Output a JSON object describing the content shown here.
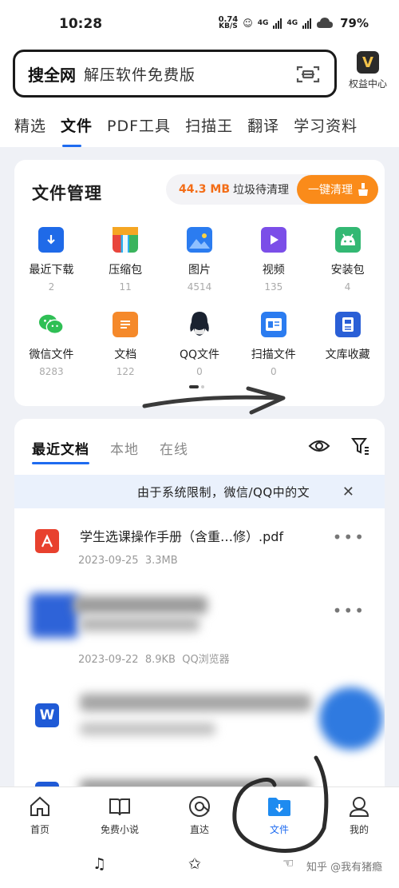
{
  "status_bar": {
    "time": "10:28",
    "net_speed_value": "0.74",
    "net_speed_unit": "KB/S",
    "sig1": "4G",
    "sig2": "4G",
    "battery": "79%"
  },
  "search": {
    "brand": "搜全网",
    "placeholder": "解压软件免费版"
  },
  "vip": {
    "badge": "V",
    "label": "权益中心"
  },
  "tabs": [
    "精选",
    "文件",
    "PDF工具",
    "扫描王",
    "翻译",
    "学习资料"
  ],
  "file_manager": {
    "title": "文件管理",
    "cleanup": {
      "size": "44.3 MB",
      "text": "垃圾待清理",
      "button": "一键清理"
    },
    "items": [
      {
        "label": "最近下载",
        "count": "2",
        "icon": "download-icon",
        "color": "#1f6ae8"
      },
      {
        "label": "压缩包",
        "count": "11",
        "icon": "zip-icon",
        "color": "#e8453c"
      },
      {
        "label": "图片",
        "count": "4514",
        "icon": "image-icon",
        "color": "#2b7cf0"
      },
      {
        "label": "视频",
        "count": "135",
        "icon": "video-icon",
        "color": "#7b4ee8"
      },
      {
        "label": "安装包",
        "count": "4",
        "icon": "android-icon",
        "color": "#33b873"
      },
      {
        "label": "微信文件",
        "count": "8283",
        "icon": "wechat-icon",
        "color": "#2fbf55"
      },
      {
        "label": "文档",
        "count": "122",
        "icon": "document-icon",
        "color": "#f5892a"
      },
      {
        "label": "QQ文件",
        "count": "0",
        "icon": "qq-icon",
        "color": "#1a2230"
      },
      {
        "label": "扫描文件",
        "count": "0",
        "icon": "scan-file-icon",
        "color": "#2b7cf0"
      },
      {
        "label": "文库收藏",
        "count": "",
        "icon": "library-icon",
        "color": "#2a5fd6"
      }
    ]
  },
  "recent": {
    "tabs": [
      "最近文档",
      "本地",
      "在线"
    ],
    "notice": "由于系统限制，微信/QQ中的文",
    "files": [
      {
        "name": "学生选课操作手册（含重…修）.pdf",
        "date": "2023-09-25",
        "size": "3.3MB",
        "source": "",
        "icon": "pdf-icon"
      },
      {
        "name": "",
        "date": "2023-09-22",
        "size": "8.9KB",
        "source": "QQ浏览器",
        "icon": "blurred-icon"
      },
      {
        "name": "",
        "date": "",
        "size": "",
        "source": "",
        "icon": "word-icon"
      },
      {
        "name": "",
        "date": "",
        "size": "",
        "source": "",
        "icon": "word-icon"
      }
    ]
  },
  "bottom_nav": [
    {
      "label": "首页",
      "icon": "home-icon"
    },
    {
      "label": "免费小说",
      "icon": "book-icon"
    },
    {
      "label": "直达",
      "icon": "compass-icon"
    },
    {
      "label": "文件",
      "icon": "folder-icon"
    },
    {
      "label": "我的",
      "icon": "profile-icon"
    }
  ],
  "watermark": "知乎 @我有猪瘾",
  "colors": {
    "accent": "#1e6bf0",
    "orange": "#fa8b1a",
    "cleanup_size": "#f36d17"
  }
}
